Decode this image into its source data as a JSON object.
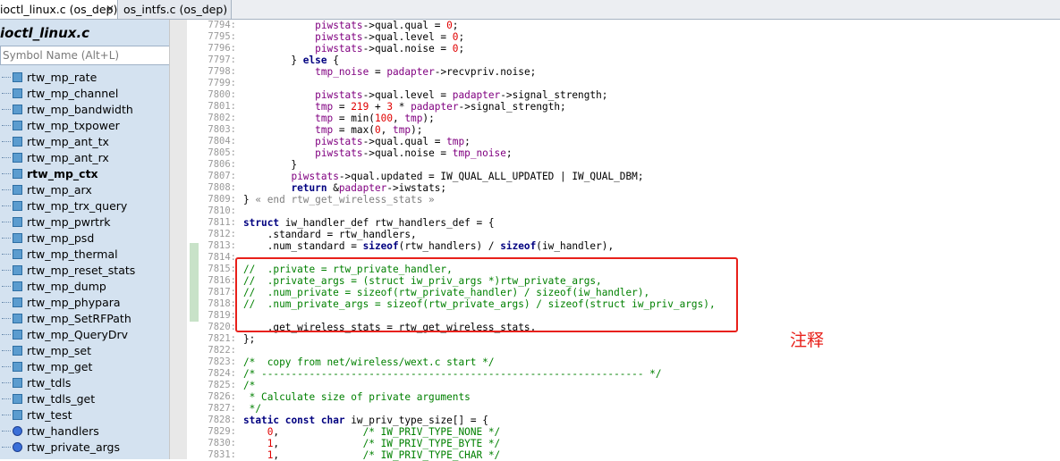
{
  "tabs": [
    {
      "label": "ioctl_linux.c (os_dep)",
      "close": "✕",
      "active": true
    },
    {
      "label": "os_intfs.c (os_dep)",
      "active": false
    }
  ],
  "symbol_panel": {
    "title": "ioctl_linux.c",
    "search_placeholder": "Symbol Name (Alt+L)",
    "items": [
      {
        "label": "rtw_mp_rate",
        "kind": "function"
      },
      {
        "label": "rtw_mp_channel",
        "kind": "function"
      },
      {
        "label": "rtw_mp_bandwidth",
        "kind": "function"
      },
      {
        "label": "rtw_mp_txpower",
        "kind": "function"
      },
      {
        "label": "rtw_mp_ant_tx",
        "kind": "function"
      },
      {
        "label": "rtw_mp_ant_rx",
        "kind": "function"
      },
      {
        "label": "rtw_mp_ctx",
        "kind": "function",
        "bold": true
      },
      {
        "label": "rtw_mp_arx",
        "kind": "function"
      },
      {
        "label": "rtw_mp_trx_query",
        "kind": "function"
      },
      {
        "label": "rtw_mp_pwrtrk",
        "kind": "function"
      },
      {
        "label": "rtw_mp_psd",
        "kind": "function"
      },
      {
        "label": "rtw_mp_thermal",
        "kind": "function"
      },
      {
        "label": "rtw_mp_reset_stats",
        "kind": "function"
      },
      {
        "label": "rtw_mp_dump",
        "kind": "function"
      },
      {
        "label": "rtw_mp_phypara",
        "kind": "function"
      },
      {
        "label": "rtw_mp_SetRFPath",
        "kind": "function"
      },
      {
        "label": "rtw_mp_QueryDrv",
        "kind": "function"
      },
      {
        "label": "rtw_mp_set",
        "kind": "function"
      },
      {
        "label": "rtw_mp_get",
        "kind": "function"
      },
      {
        "label": "rtw_tdls",
        "kind": "function"
      },
      {
        "label": "rtw_tdls_get",
        "kind": "function"
      },
      {
        "label": "rtw_test",
        "kind": "function"
      },
      {
        "label": "rtw_handlers",
        "kind": "variable"
      },
      {
        "label": "rtw_private_args",
        "kind": "variable"
      }
    ]
  },
  "editor": {
    "line_numbers": [
      "7794:",
      "7795:",
      "7796:",
      "7797:",
      "7798:",
      "7799:",
      "7800:",
      "7801:",
      "7802:",
      "7803:",
      "7804:",
      "7805:",
      "7806:",
      "7807:",
      "7808:",
      "7809:",
      "7810:",
      "7811:",
      "7812:",
      "7813:",
      "7814:",
      "7815:",
      "7816:",
      "7817:",
      "7818:",
      "7819:",
      "7820:",
      "7821:",
      "7822:",
      "7823:",
      "7824:",
      "7825:",
      "7826:",
      "7827:",
      "7828:",
      "7829:",
      "7830:",
      "7831:"
    ],
    "lines": [
      "            piwstats->qual.qual = 0;",
      "            piwstats->qual.level = 0;",
      "            piwstats->qual.noise = 0;",
      "        } else {",
      "            tmp_noise = padapter->recvpriv.noise;",
      "",
      "            piwstats->qual.level = padapter->signal_strength;",
      "            tmp = 219 + 3 * padapter->signal_strength;",
      "            tmp = min(100, tmp);",
      "            tmp = max(0, tmp);",
      "            piwstats->qual.qual = tmp;",
      "            piwstats->qual.noise = tmp_noise;",
      "        }",
      "        piwstats->qual.updated = IW_QUAL_ALL_UPDATED | IW_QUAL_DBM;",
      "        return &padapter->iwstats;",
      "} « end rtw_get_wireless_stats »",
      "",
      "struct iw_handler_def rtw_handlers_def = {",
      "    .standard = rtw_handlers,",
      "    .num_standard = sizeof(rtw_handlers) / sizeof(iw_handler),",
      "",
      "//  .private = rtw_private_handler,",
      "//  .private_args = (struct iw_priv_args *)rtw_private_args,",
      "//  .num_private = sizeof(rtw_private_handler) / sizeof(iw_handler),",
      "//  .num_private_args = sizeof(rtw_private_args) / sizeof(struct iw_priv_args),",
      "",
      "    .get_wireless_stats = rtw_get_wireless_stats,",
      "};",
      "",
      "/*  copy from net/wireless/wext.c start */",
      "/* ---------------------------------------------------------------- */",
      "/*",
      " * Calculate size of private arguments",
      " */",
      "static const char iw_priv_type_size[] = {",
      "    0,              /* IW_PRIV_TYPE_NONE */",
      "    1,              /* IW_PRIV_TYPE_BYTE */",
      "    1,              /* IW_PRIV_TYPE_CHAR */"
    ]
  },
  "annotation": {
    "note": "注释",
    "box_color": "#e8201a"
  }
}
